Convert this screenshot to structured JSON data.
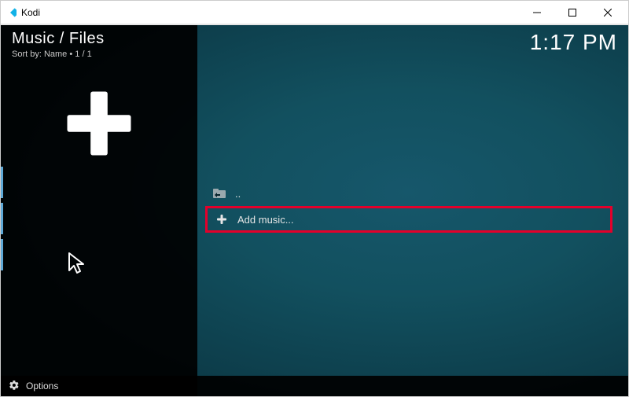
{
  "titlebar": {
    "app_name": "Kodi"
  },
  "header": {
    "breadcrumb": "Music / Files",
    "sort_label": "Sort by: Name",
    "position_indicator": "1 / 1",
    "clock": "1:17 PM"
  },
  "sidebar": {
    "big_icon": "plus-icon"
  },
  "list": {
    "parent_label": "..",
    "add_music_label": "Add music..."
  },
  "footer": {
    "options_label": "Options"
  },
  "colors": {
    "highlight": "#e4002b",
    "bg_dark": "#051a22",
    "bg_teal": "#16576b"
  }
}
